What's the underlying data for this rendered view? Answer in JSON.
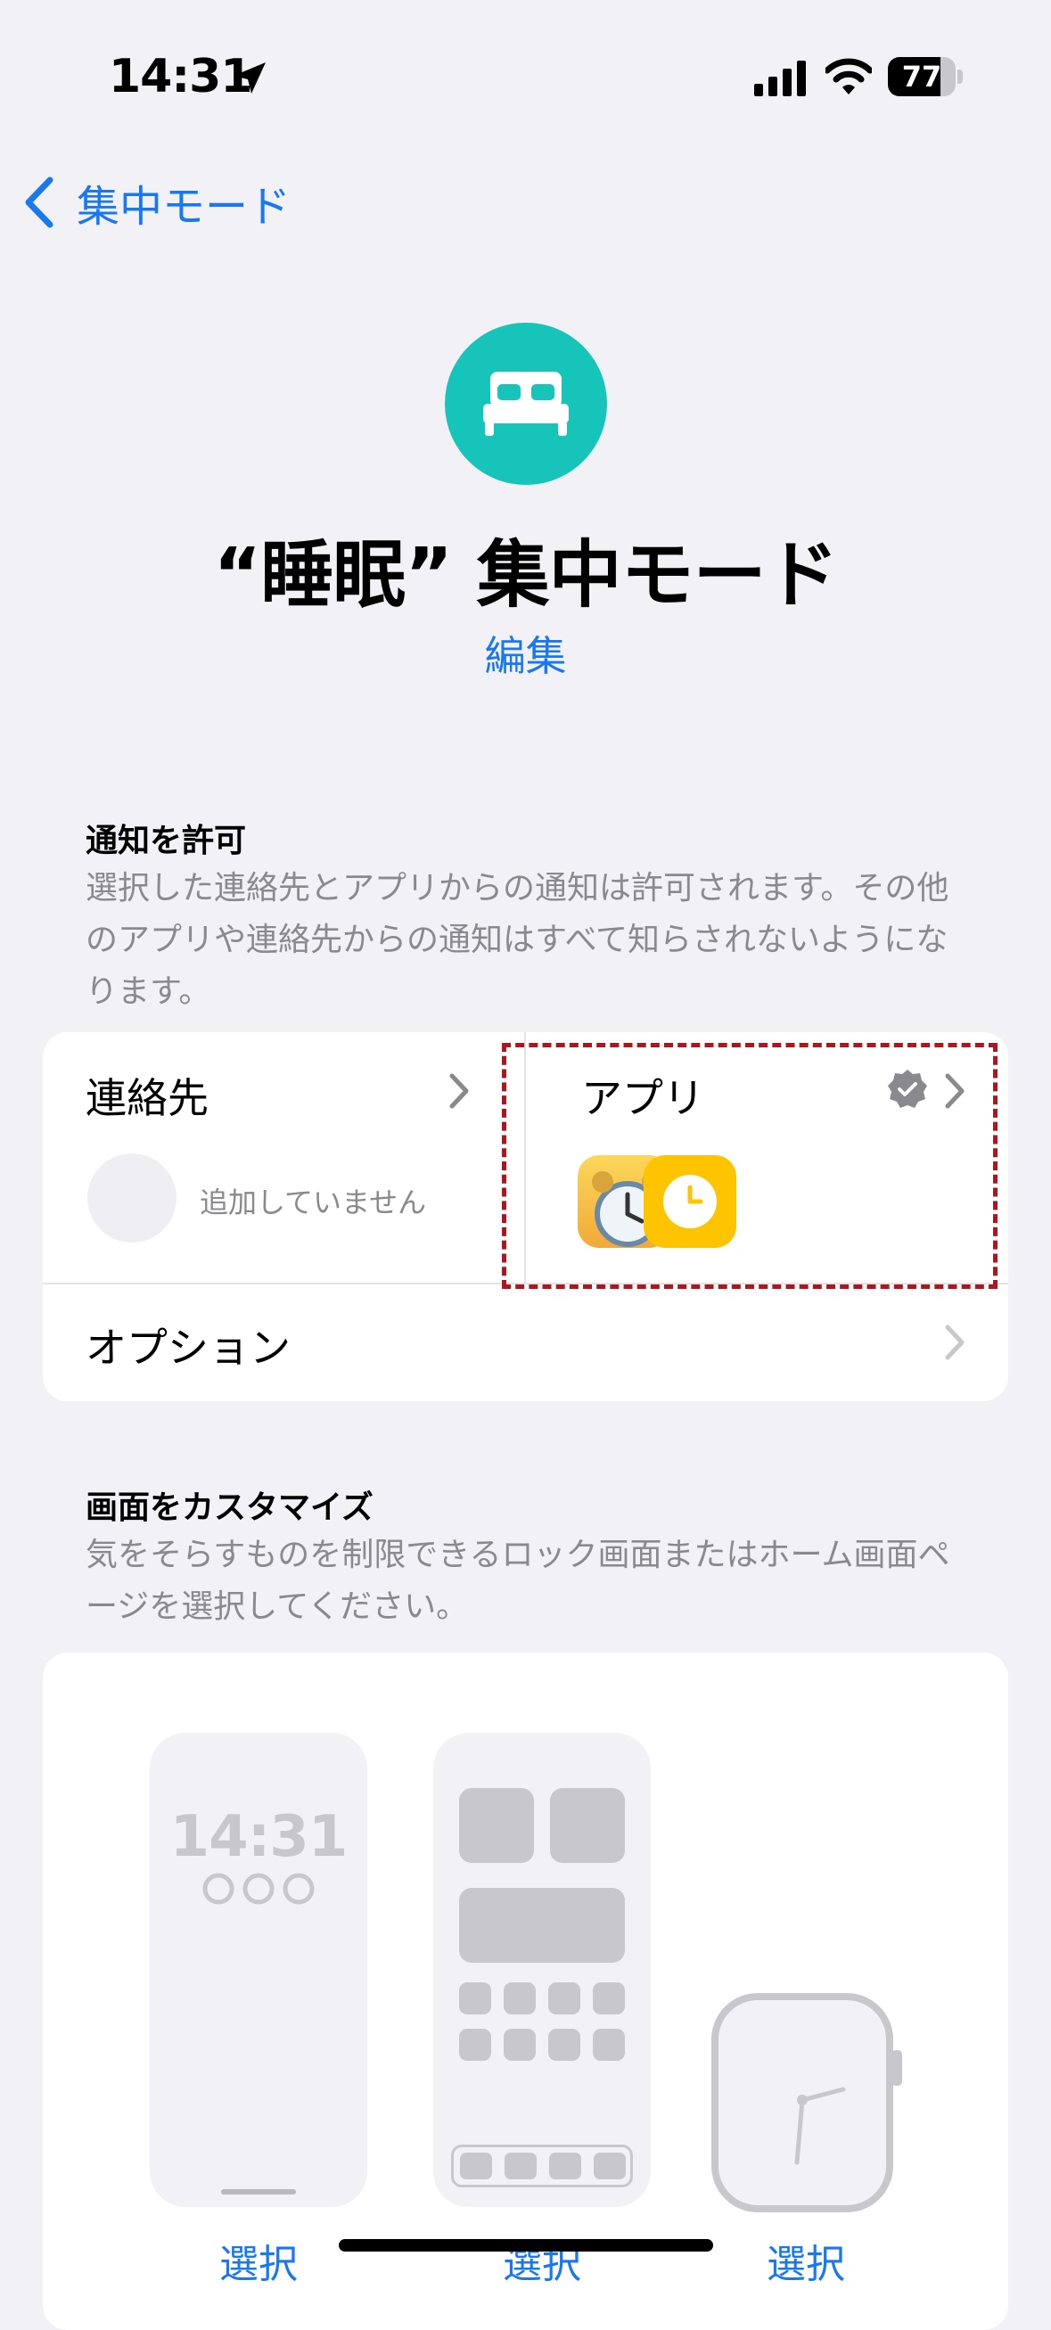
{
  "status_bar": {
    "time": "14:31",
    "battery": "77",
    "battery_level": 0.77
  },
  "nav": {
    "back_label": "集中モード"
  },
  "header": {
    "title": "“睡眠” 集中モード",
    "edit_label": "編集",
    "icon": "bed-icon",
    "icon_color": "#17c4b9"
  },
  "allow": {
    "title": "通知を許可",
    "description": "選択した連絡先とアプリからの通知は許可されます。その他のアプリや連絡先からの通知はすべて知らされないようになります。",
    "contacts": {
      "label": "連絡先",
      "empty_text": "追加していません"
    },
    "apps": {
      "label": "アプリ",
      "icons": [
        "alarm-clock-app-icon",
        "clock-app-icon"
      ]
    },
    "options": {
      "label": "オプション"
    }
  },
  "customize": {
    "title": "画面をカスタマイズ",
    "description": "気をそらすものを制限できるロック画面またはホーム画面ページを選択してください。",
    "lock_time": "14:31",
    "select_label": "選択"
  },
  "colors": {
    "accent": "#1877f2",
    "highlight": "#b0141e",
    "background": "#f2f1f6"
  }
}
